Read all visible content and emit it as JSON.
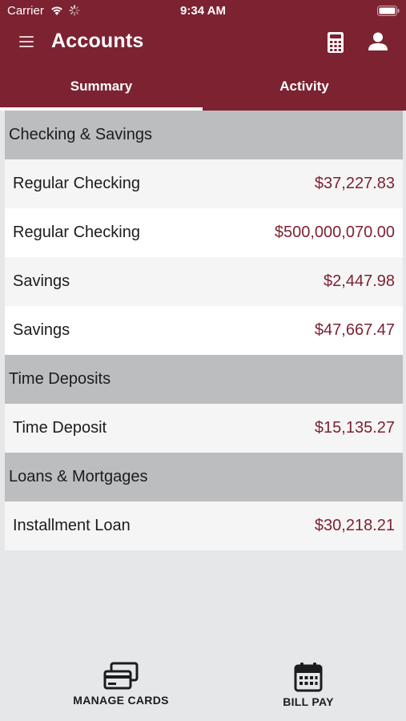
{
  "status": {
    "carrier": "Carrier",
    "time": "9:34 AM"
  },
  "header": {
    "title": "Accounts",
    "icons": [
      "menu-icon",
      "calculator-icon",
      "user-icon"
    ]
  },
  "tabs": [
    {
      "label": "Summary",
      "active": true
    },
    {
      "label": "Activity",
      "active": false
    }
  ],
  "sections": [
    {
      "title": "Checking & Savings",
      "accounts": [
        {
          "name": "Regular Checking",
          "amount": "$37,227.83"
        },
        {
          "name": "Regular Checking",
          "amount": "$500,000,070.00"
        },
        {
          "name": "Savings",
          "amount": "$2,447.98"
        },
        {
          "name": "Savings",
          "amount": "$47,667.47"
        }
      ]
    },
    {
      "title": "Time Deposits",
      "accounts": [
        {
          "name": "Time Deposit",
          "amount": "$15,135.27"
        }
      ]
    },
    {
      "title": "Loans & Mortgages",
      "accounts": [
        {
          "name": "Installment Loan",
          "amount": "$30,218.21"
        }
      ]
    }
  ],
  "bottom_bar": {
    "manage_cards": {
      "label": "MANAGE CARDS",
      "icon": "cards-icon"
    },
    "bill_pay": {
      "label": "BILL PAY",
      "icon": "calendar-icon"
    }
  },
  "colors": {
    "brand": "#7c2231",
    "section_bg": "#bcbdbe",
    "page_bg": "#e6e7e8"
  }
}
